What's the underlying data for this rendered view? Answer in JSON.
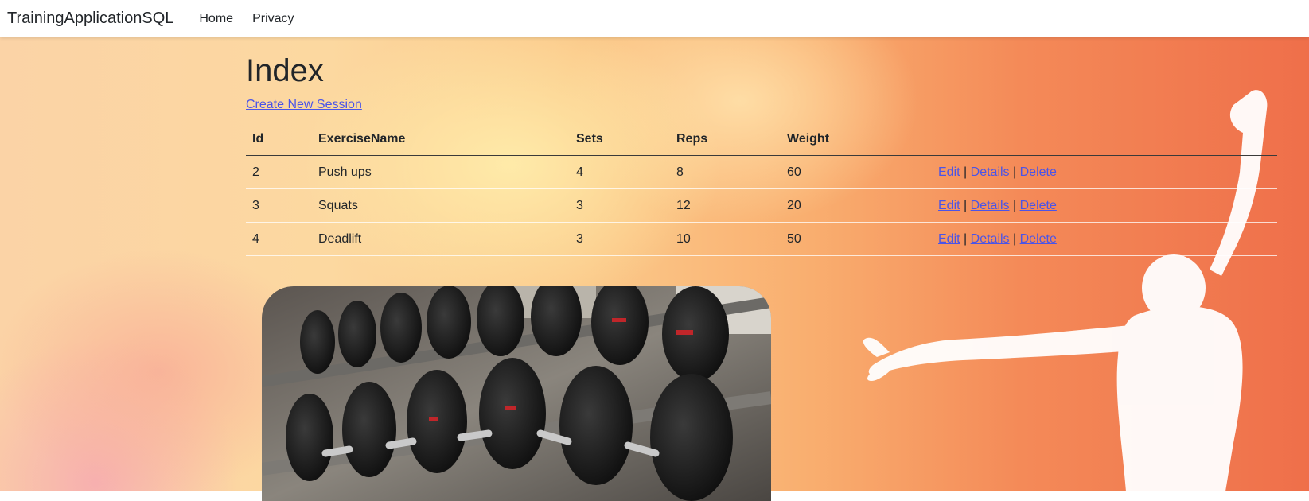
{
  "navbar": {
    "brand": "TrainingApplicationSQL",
    "links": [
      "Home",
      "Privacy"
    ]
  },
  "page": {
    "title": "Index",
    "create_link": "Create New Session"
  },
  "table": {
    "headers": [
      "Id",
      "ExerciseName",
      "Sets",
      "Reps",
      "Weight"
    ],
    "rows": [
      {
        "id": "2",
        "name": "Push ups",
        "sets": "4",
        "reps": "8",
        "weight": "60"
      },
      {
        "id": "3",
        "name": "Squats",
        "sets": "3",
        "reps": "12",
        "weight": "20"
      },
      {
        "id": "4",
        "name": "Deadlift",
        "sets": "3",
        "reps": "10",
        "weight": "50"
      }
    ],
    "actions": {
      "edit": "Edit",
      "details": "Details",
      "delete": "Delete",
      "separator": "|"
    }
  },
  "colors": {
    "link": "#4a54e8",
    "text": "#212529",
    "background_warm": "#f48a58"
  },
  "images": {
    "background": "watercolor-orange-background-with-dancer-silhouette",
    "photo": "dumbbell-rack-photo"
  }
}
